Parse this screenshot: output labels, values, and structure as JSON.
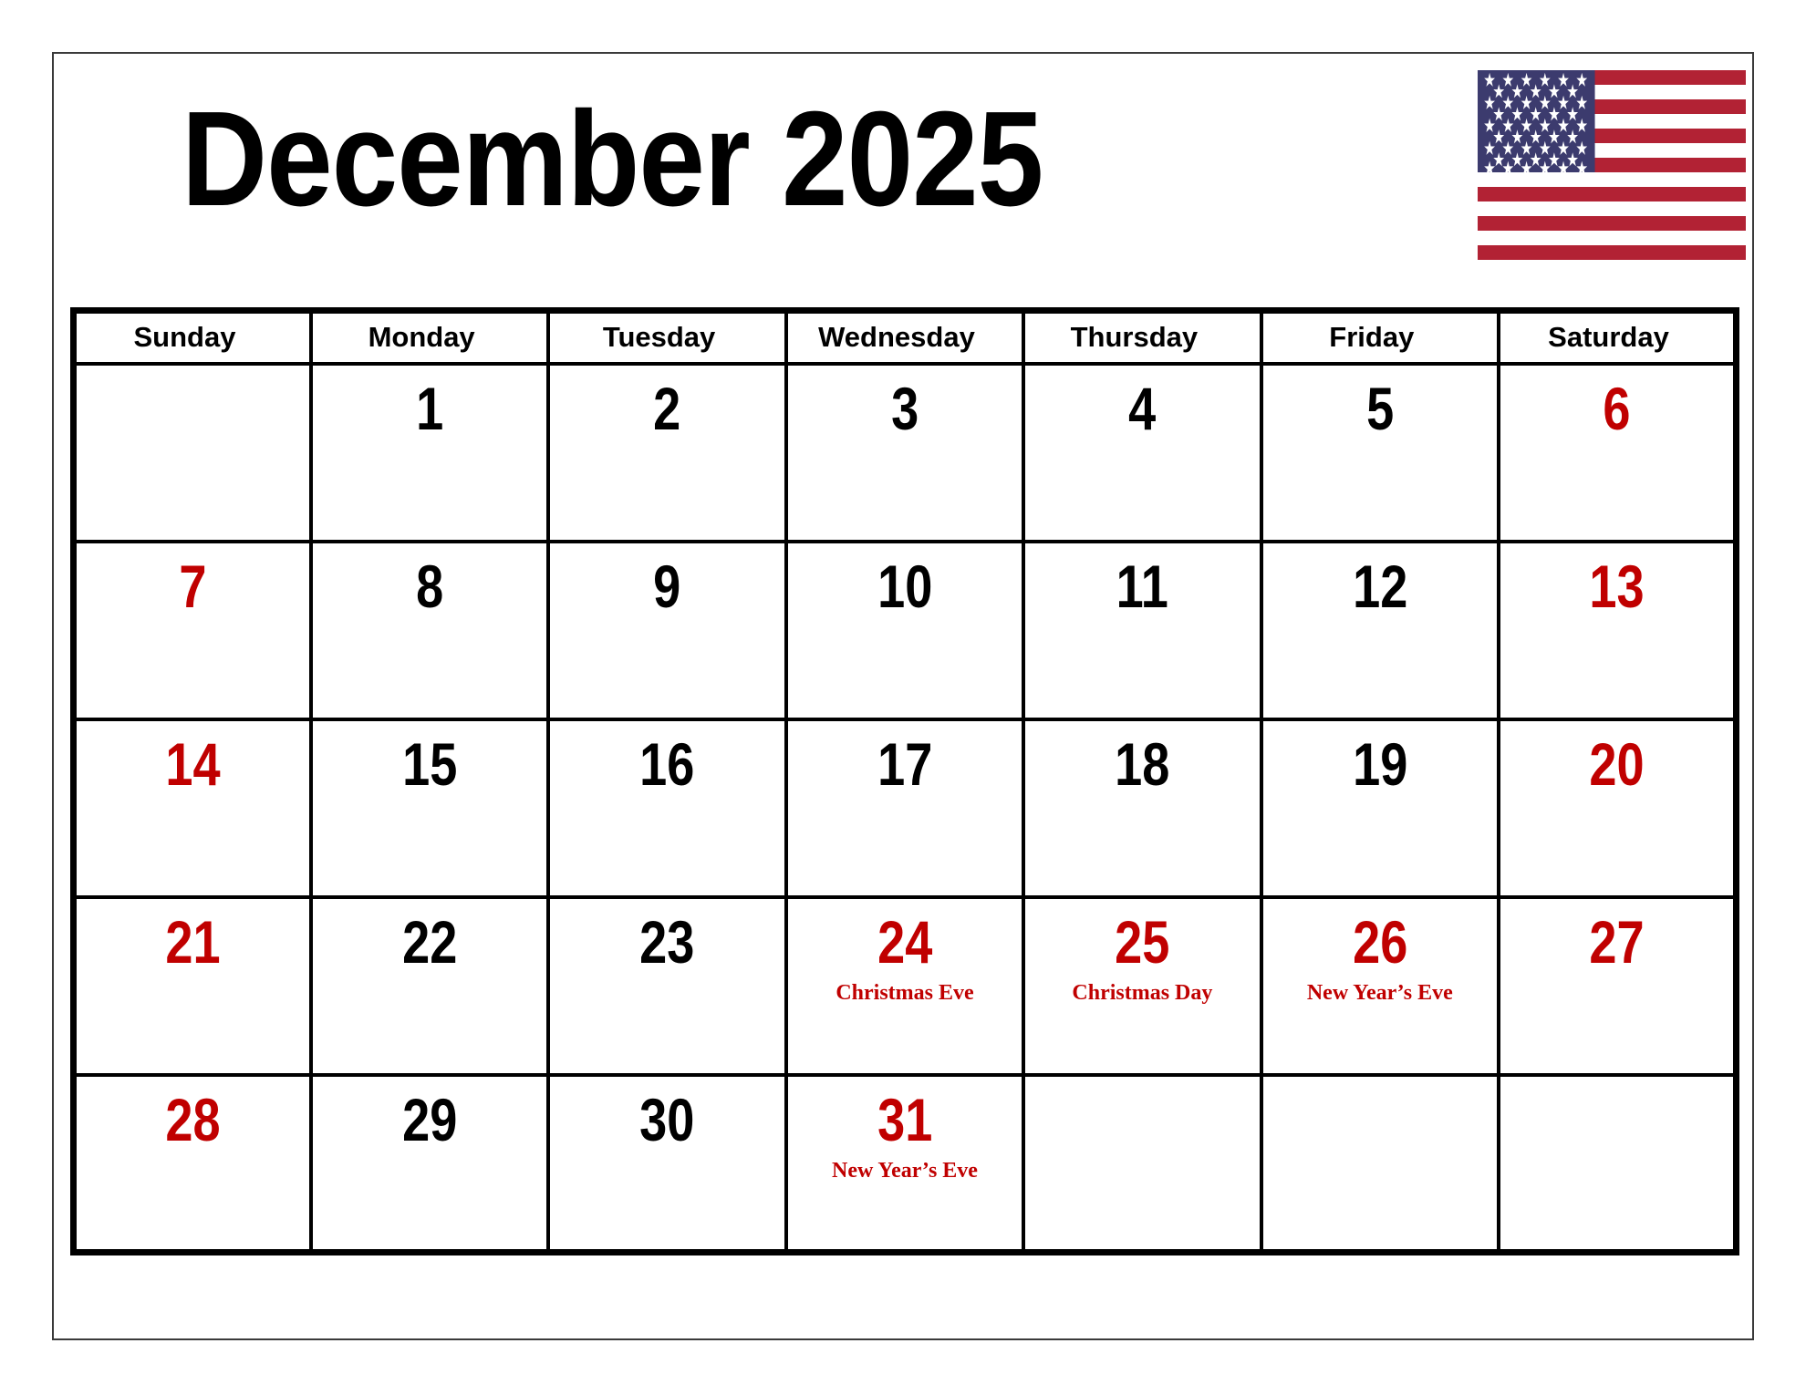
{
  "page": {
    "title": "December 2025",
    "month": "December",
    "year": "2025"
  },
  "flag": {
    "name": "united-states-flag",
    "canton_color": "#3C3B6E",
    "stripe_color": "#B22234",
    "star_color": "#FFFFFF",
    "stars": 50,
    "stripes": 13
  },
  "colors": {
    "weekend": "#C00000",
    "weekday": "#000000",
    "holiday": "#C00000",
    "grid": "#000000",
    "page_border": "#3A3A3A"
  },
  "weekdays": [
    "Sunday",
    "Monday",
    "Tuesday",
    "Wednesday",
    "Thursday",
    "Friday",
    "Saturday"
  ],
  "weeks": [
    [
      {
        "day": "",
        "holiday": "",
        "weekend": true,
        "empty": true
      },
      {
        "day": "1",
        "holiday": "",
        "weekend": false,
        "empty": false
      },
      {
        "day": "2",
        "holiday": "",
        "weekend": false,
        "empty": false
      },
      {
        "day": "3",
        "holiday": "",
        "weekend": false,
        "empty": false
      },
      {
        "day": "4",
        "holiday": "",
        "weekend": false,
        "empty": false
      },
      {
        "day": "5",
        "holiday": "",
        "weekend": false,
        "empty": false
      },
      {
        "day": "6",
        "holiday": "",
        "weekend": true,
        "empty": false
      }
    ],
    [
      {
        "day": "7",
        "holiday": "",
        "weekend": true,
        "empty": false
      },
      {
        "day": "8",
        "holiday": "",
        "weekend": false,
        "empty": false
      },
      {
        "day": "9",
        "holiday": "",
        "weekend": false,
        "empty": false
      },
      {
        "day": "10",
        "holiday": "",
        "weekend": false,
        "empty": false
      },
      {
        "day": "11",
        "holiday": "",
        "weekend": false,
        "empty": false
      },
      {
        "day": "12",
        "holiday": "",
        "weekend": false,
        "empty": false
      },
      {
        "day": "13",
        "holiday": "",
        "weekend": true,
        "empty": false
      }
    ],
    [
      {
        "day": "14",
        "holiday": "",
        "weekend": true,
        "empty": false
      },
      {
        "day": "15",
        "holiday": "",
        "weekend": false,
        "empty": false
      },
      {
        "day": "16",
        "holiday": "",
        "weekend": false,
        "empty": false
      },
      {
        "day": "17",
        "holiday": "",
        "weekend": false,
        "empty": false
      },
      {
        "day": "18",
        "holiday": "",
        "weekend": false,
        "empty": false
      },
      {
        "day": "19",
        "holiday": "",
        "weekend": false,
        "empty": false
      },
      {
        "day": "20",
        "holiday": "",
        "weekend": true,
        "empty": false
      }
    ],
    [
      {
        "day": "21",
        "holiday": "",
        "weekend": true,
        "empty": false
      },
      {
        "day": "22",
        "holiday": "",
        "weekend": false,
        "empty": false
      },
      {
        "day": "23",
        "holiday": "",
        "weekend": false,
        "empty": false
      },
      {
        "day": "24",
        "holiday": "Christmas Eve",
        "weekend": false,
        "empty": false
      },
      {
        "day": "25",
        "holiday": "Christmas Day",
        "weekend": false,
        "empty": false
      },
      {
        "day": "26",
        "holiday": "New Year’s Eve",
        "weekend": false,
        "empty": false
      },
      {
        "day": "27",
        "holiday": "",
        "weekend": true,
        "empty": false
      }
    ],
    [
      {
        "day": "28",
        "holiday": "",
        "weekend": true,
        "empty": false
      },
      {
        "day": "29",
        "holiday": "",
        "weekend": false,
        "empty": false
      },
      {
        "day": "30",
        "holiday": "",
        "weekend": false,
        "empty": false
      },
      {
        "day": "31",
        "holiday": "New Year’s Eve",
        "weekend": false,
        "empty": false
      },
      {
        "day": "",
        "holiday": "",
        "weekend": false,
        "empty": true
      },
      {
        "day": "",
        "holiday": "",
        "weekend": false,
        "empty": true
      },
      {
        "day": "",
        "holiday": "",
        "weekend": true,
        "empty": true
      }
    ]
  ]
}
